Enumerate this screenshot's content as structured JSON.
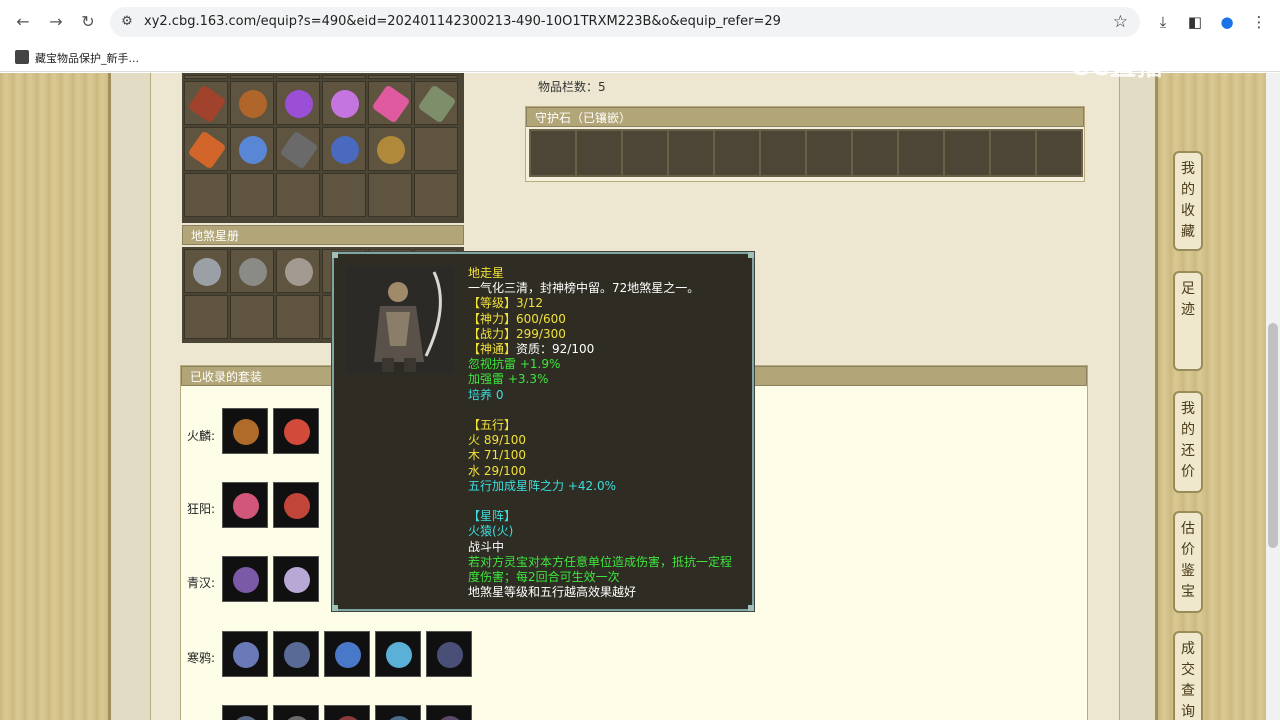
{
  "browser": {
    "url": "xy2.cbg.163.com/equip?s=490&eid=202401142300213-490-10O1TRXM223B&o&equip_refer=29",
    "bookmark": "藏宝物品保护_新手..."
  },
  "watermark": "CC直播",
  "inventory": {
    "item_count": "物品栏数：5"
  },
  "guard_stone": {
    "title": "守护石（已镶嵌）"
  },
  "star_book": {
    "title": "地煞星册"
  },
  "outfits": {
    "title": "已收录的套装",
    "rows": [
      {
        "label": "火麟:"
      },
      {
        "label": "狂阳:"
      },
      {
        "label": "青汉:"
      },
      {
        "label": "寒鸦:"
      }
    ]
  },
  "tooltip": {
    "name": "地走星",
    "desc": "一气化三清，封神榜中留。72地煞星之一。",
    "level_key": "【等级】",
    "level_val": "3/12",
    "shenli_key": "【神力】",
    "shenli_val": "600/600",
    "zhanli_key": "【战力】",
    "zhanli_val": "299/300",
    "shentong_key": "【神通】",
    "shentong_val": "资质：92/100",
    "attr1": "忽视抗雷 +1.9%",
    "attr2": "加强雷 +3.3%",
    "peiyang": "培养 0",
    "wuxing_title": "【五行】",
    "fire": "火 89/100",
    "wood": "木 71/100",
    "water": "水 29/100",
    "wuxing_bonus": "五行加成星阵之力 +42.0%",
    "xingzhen_title": "【星阵】",
    "xingzhen_name": "火猿(火)",
    "status": "战斗中",
    "effect1": "若对方灵宝对本方任意单位造成伤害，抵抗一定程",
    "effect2": "度伤害；每2回合可生效一次",
    "note": "地煞星等级和五行越高效果越好"
  },
  "right_nav": [
    {
      "label": "我的收藏"
    },
    {
      "label": "足迹"
    },
    {
      "label": "我的还价"
    },
    {
      "label": "估价鉴宝"
    },
    {
      "label": "成交查询"
    }
  ],
  "colors": {
    "tooltip_bg": "#2e2c23",
    "yellow": "#f2e23a",
    "green": "#3ee63e",
    "cyan": "#3bdede",
    "panel_title": "#b2a578"
  }
}
